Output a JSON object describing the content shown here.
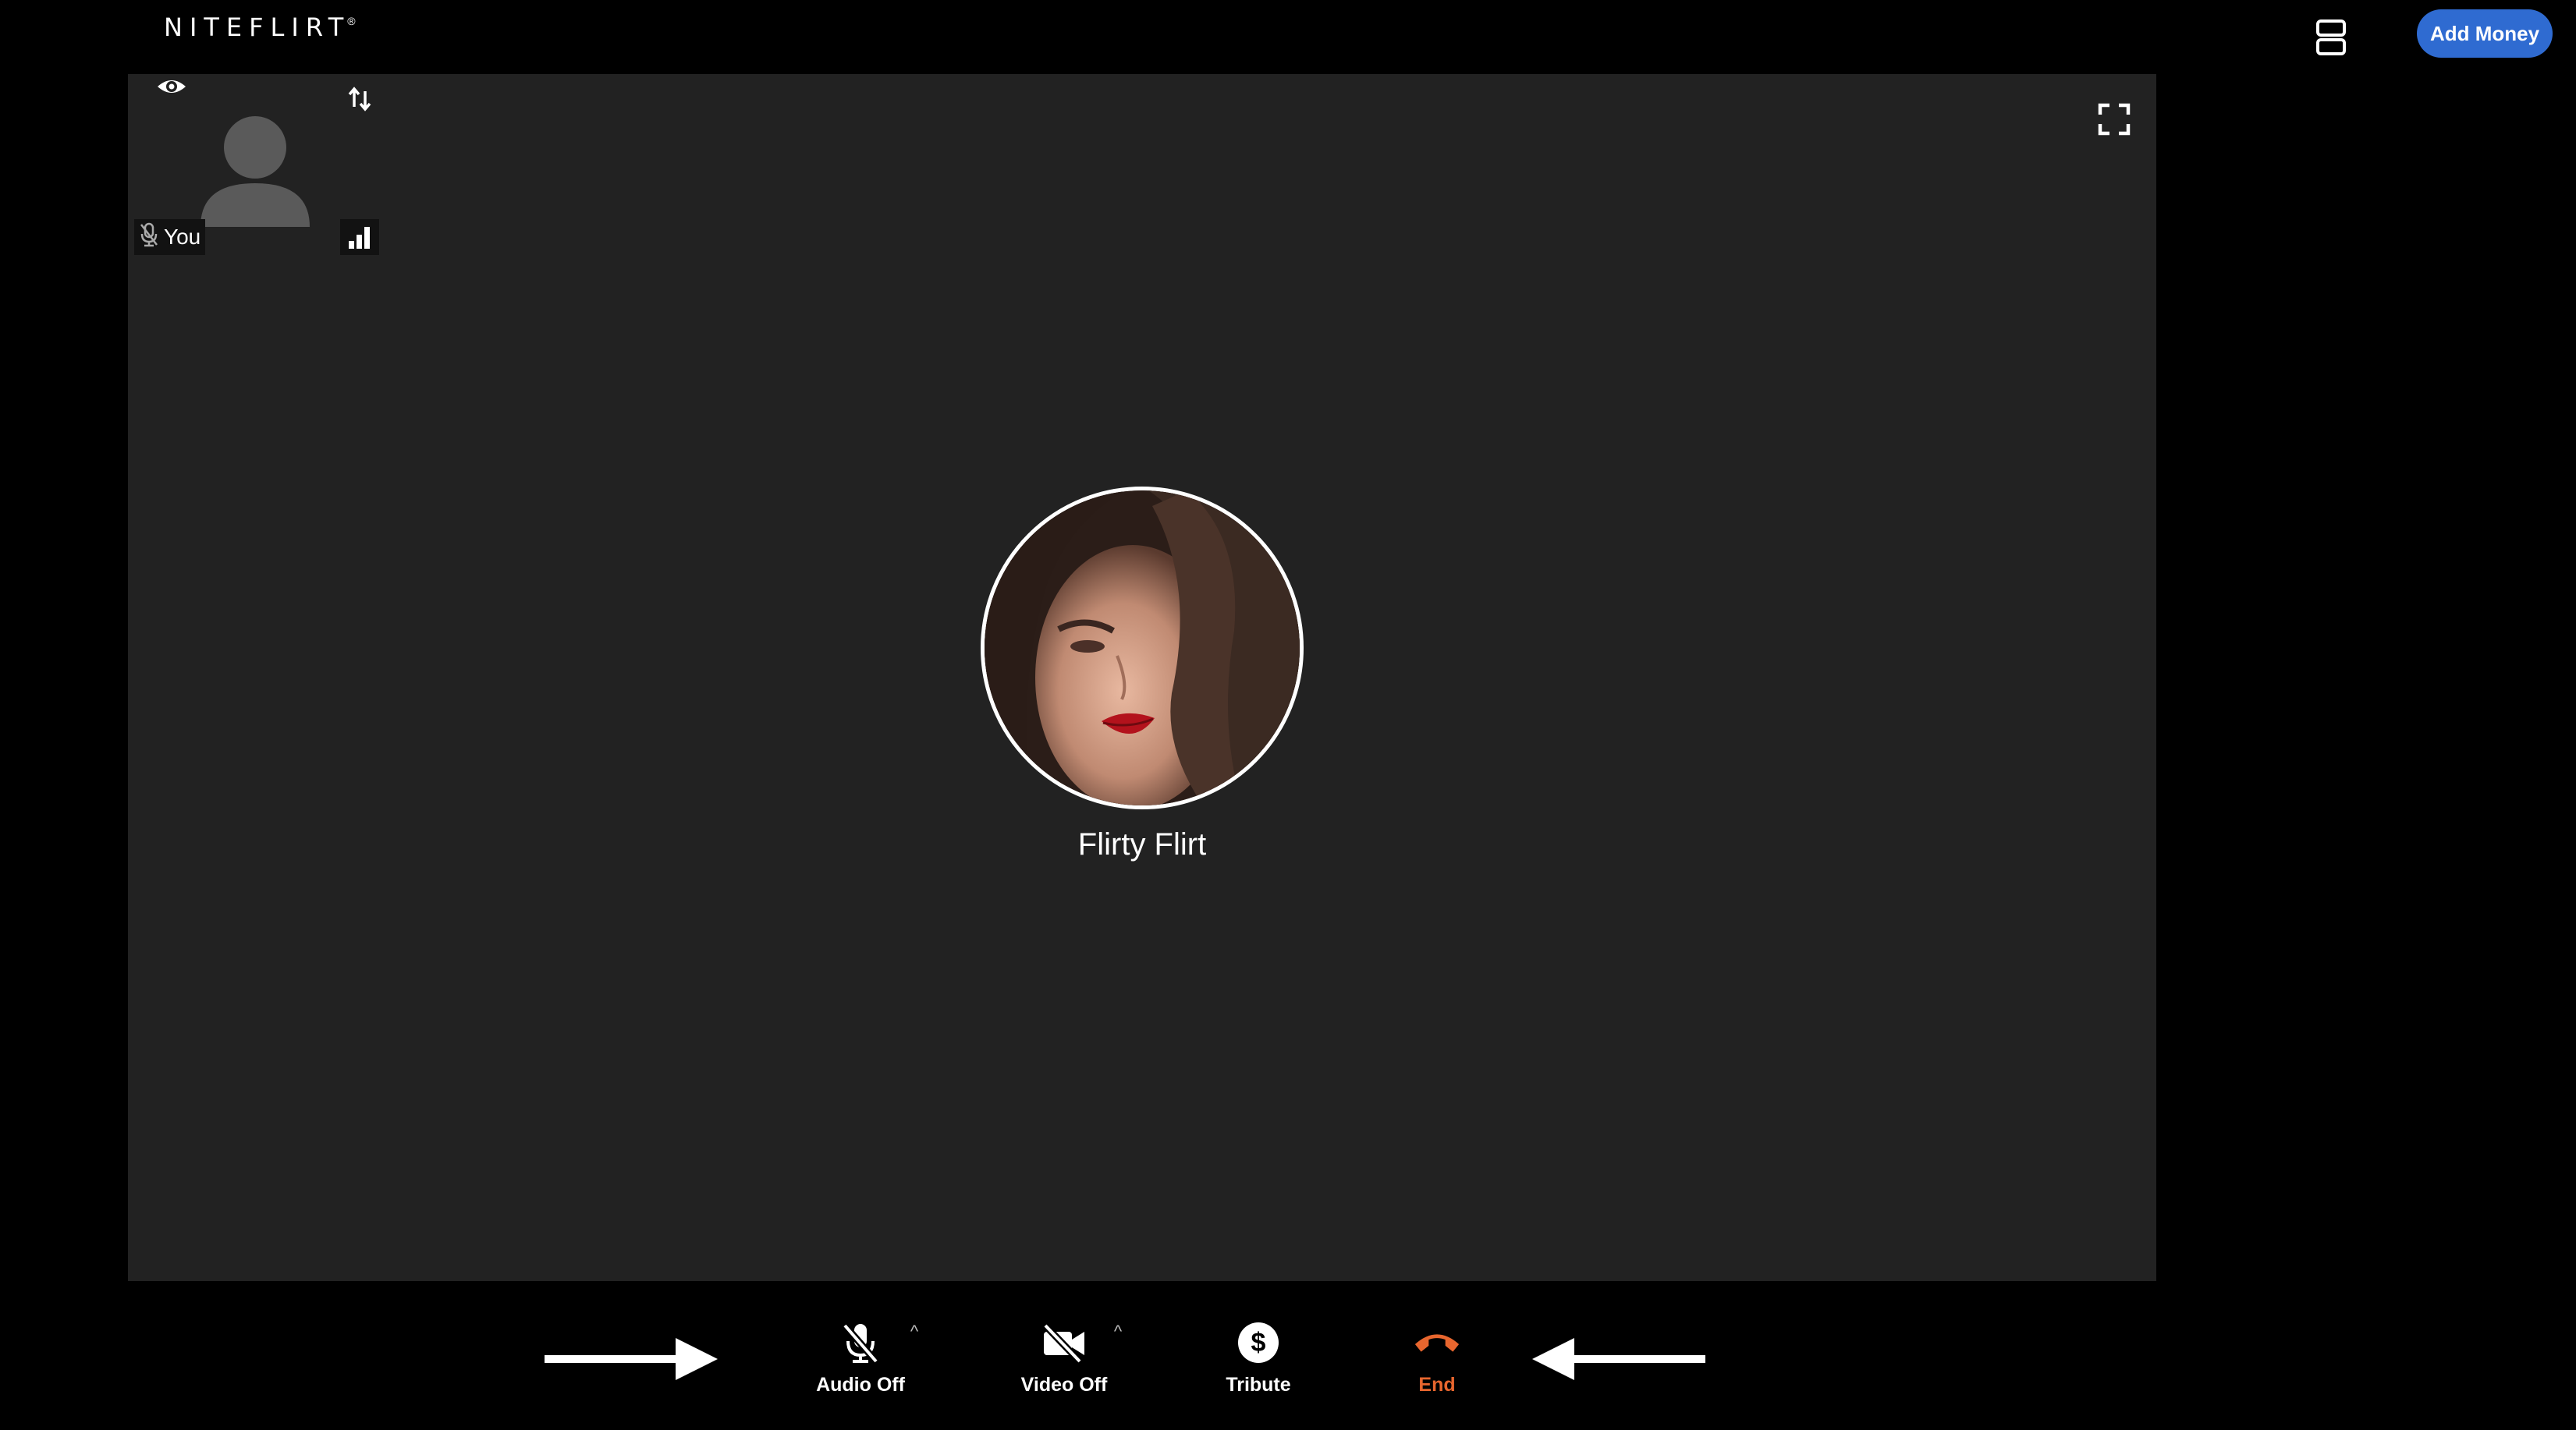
{
  "header": {
    "logo_text": "NITEFLIRT",
    "logo_reg": "®",
    "layout_toggle_icon": "layout-rows-icon",
    "add_money_label": "Add Money",
    "accent_color": "#2f6bd1"
  },
  "self_view": {
    "label": "You",
    "icons": [
      "eye-icon",
      "swap-icon",
      "mic-muted-icon",
      "signal-icon",
      "person-placeholder-icon"
    ]
  },
  "remote": {
    "name": "Flirty Flirt",
    "avatar": "profile-photo"
  },
  "controls": [
    {
      "id": "audio",
      "label": "Audio Off",
      "icon": "mic-off-icon"
    },
    {
      "id": "video",
      "label": "Video Off",
      "icon": "video-off-icon"
    },
    {
      "id": "tribute",
      "label": "Tribute",
      "icon": "dollar-icon"
    },
    {
      "id": "end",
      "label": "End",
      "icon": "phone-hangup-icon",
      "color": "#e8662e"
    }
  ],
  "colors": {
    "background": "#000000",
    "stage": "#222222",
    "end": "#e8662e"
  }
}
